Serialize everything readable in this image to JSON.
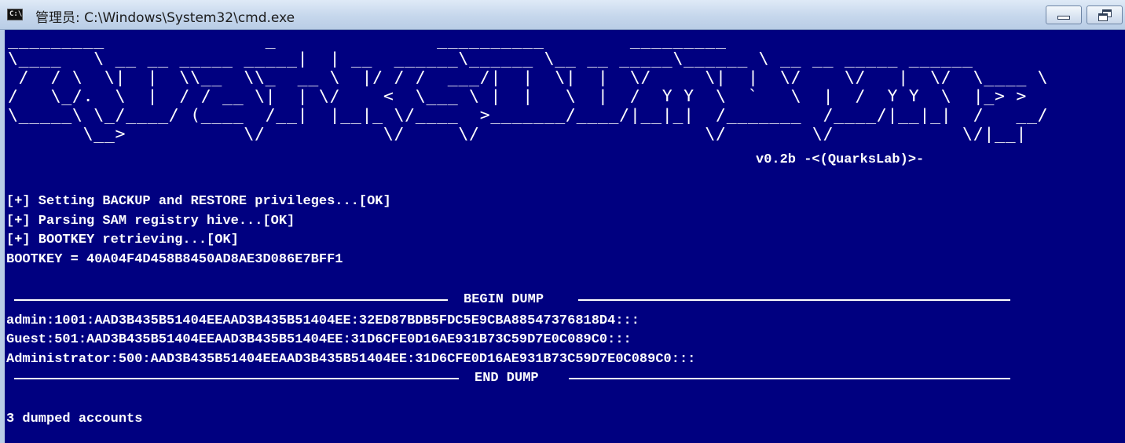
{
  "window": {
    "title": "管理员: C:\\Windows\\System32\\cmd.exe",
    "icon_text": "C:\\",
    "icons": {
      "app": "cmd-console-icon",
      "minimize": "minimize-icon",
      "restore": "restore-icon"
    }
  },
  "colors": {
    "console_background": "#000080",
    "console_text": "#ffffff",
    "titlebar": "#c6d7ec"
  },
  "console": {
    "banner_art": [
      "_________               _               __________        _________",
      "\\____   \\ __ __ _____ _____|  | __  ______\\______ \\__ __ _____\\______ \\ __ __ _____ ______ ",
      " /  / \\  \\|  |  \\\\__  \\\\_  __ \\  |/ / /  ___/|  |  \\|  |  \\/     \\|  |  \\/    \\/   |  \\/  \\____ \\",
      "/   \\_/.  \\  |  / / __ \\|  | \\/    <  \\___ \\ |  |   \\  |  /  Y Y  \\  `   \\  |  /  Y Y  \\  |_> >",
      "\\_____\\ \\_/____/ (____  /__|  |__|_ \\/____  >_______/____/|__|_|  /_______  /____/|__|_|  /   __/",
      "       \\__>           \\/           \\/     \\/                     \\/        \\/            \\/|__|"
    ],
    "version": "v0.2b -<(QuarksLab)>-",
    "status_lines": [
      "[+] Setting BACKUP and RESTORE privileges...[OK]",
      "[+] Parsing SAM registry hive...[OK]",
      "[+] BOOTKEY retrieving...[OK]",
      "BOOTKEY = 40A04F4D458B8450AD8AE3D086E7BFF1"
    ],
    "begin_label": "BEGIN DUMP",
    "end_label": "END DUMP",
    "dump_lines": [
      "admin:1001:AAD3B435B51404EEAAD3B435B51404EE:32ED87BDB5FDC5E9CBA88547376818D4:::",
      "Guest:501:AAD3B435B51404EEAAD3B435B51404EE:31D6CFE0D16AE931B73C59D7E0C089C0:::",
      "Administrator:500:AAD3B435B51404EEAAD3B435B51404EE:31D6CFE0D16AE931B73C59D7E0C089C0:::"
    ],
    "summary": "3 dumped accounts"
  }
}
